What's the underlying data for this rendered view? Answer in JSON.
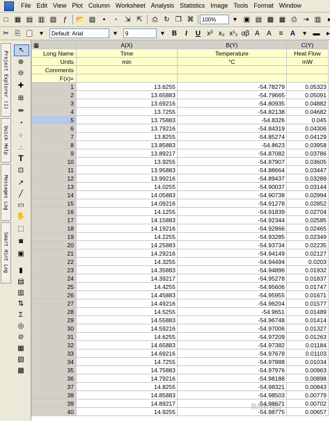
{
  "menu": [
    "File",
    "Edit",
    "View",
    "Plot",
    "Column",
    "Worksheet",
    "Analysis",
    "Statistics",
    "Image",
    "Tools",
    "Format",
    "Window"
  ],
  "toolbar": {
    "zoom": "100%",
    "font": "Default: Arial",
    "size": "9"
  },
  "side_tabs": [
    "Project Explorer (1)",
    "Quick Help",
    "Messages Log",
    "Smart Hint Log"
  ],
  "columns": [
    {
      "header": "A(X)",
      "long_name": "Time",
      "units": "min"
    },
    {
      "header": "B(Y)",
      "long_name": "Temperature",
      "units": "°C"
    },
    {
      "header": "C(Y)",
      "long_name": "Heat Flow",
      "units": "mW"
    }
  ],
  "meta_labels": [
    "Long Name",
    "Units",
    "Comments",
    "F(x)="
  ],
  "rows": [
    [
      "1",
      "13.6255",
      "-54.78279",
      "0.05323"
    ],
    [
      "2",
      "13.65883",
      "-54.79665",
      "0.05091"
    ],
    [
      "3",
      "13.69216",
      "-54.80935",
      "0.04882"
    ],
    [
      "4",
      "13.7255",
      "-54.82138",
      "0.04682"
    ],
    [
      "5",
      "13.75883",
      "-54.8326",
      "0.045"
    ],
    [
      "6",
      "13.79216",
      "-54.84319",
      "0.04306"
    ],
    [
      "7",
      "13.8255",
      "-54.85274",
      "0.04129"
    ],
    [
      "8",
      "13.85883",
      "-54.8623",
      "0.03958"
    ],
    [
      "9",
      "13.89217",
      "-54.87082",
      "0.03786"
    ],
    [
      "10",
      "13.9255",
      "-54.87907",
      "0.03605"
    ],
    [
      "11",
      "13.95883",
      "-54.88664",
      "0.03447"
    ],
    [
      "12",
      "13.99216",
      "-54.89437",
      "0.03289"
    ],
    [
      "13",
      "14.0255",
      "-54.90037",
      "0.03144"
    ],
    [
      "14",
      "14.05883",
      "-54.90738",
      "0.02994"
    ],
    [
      "15",
      "14.09216",
      "-54.91278",
      "0.02852"
    ],
    [
      "16",
      "14.1255",
      "-54.91839",
      "0.02704"
    ],
    [
      "17",
      "14.15883",
      "-54.92344",
      "0.02585"
    ],
    [
      "18",
      "14.19216",
      "-54.92866",
      "0.02465"
    ],
    [
      "19",
      "14.2255",
      "-54.93285",
      "0.02349"
    ],
    [
      "20",
      "14.25883",
      "-54.93734",
      "0.02235"
    ],
    [
      "21",
      "14.29216",
      "-54.94149",
      "0.02127"
    ],
    [
      "22",
      "14.3255",
      "-54.94494",
      "0.0203"
    ],
    [
      "23",
      "14.35883",
      "-54.94896",
      "0.01932"
    ],
    [
      "24",
      "14.39217",
      "-54.95278",
      "0.01837"
    ],
    [
      "25",
      "14.4255",
      "-54.95606",
      "0.01747"
    ],
    [
      "26",
      "14.45883",
      "-54.95955",
      "0.01671"
    ],
    [
      "27",
      "14.49216",
      "-54.96204",
      "0.01577"
    ],
    [
      "28",
      "14.5255",
      "-54.9651",
      "0.01489"
    ],
    [
      "29",
      "14.55883",
      "-54.96748",
      "0.01414"
    ],
    [
      "30",
      "14.59216",
      "-54.97006",
      "0.01327"
    ],
    [
      "31",
      "14.6255",
      "-54.97209",
      "0.01263"
    ],
    [
      "32",
      "14.65883",
      "-54.97382",
      "0.01184"
    ],
    [
      "33",
      "14.69216",
      "-54.97678",
      "0.01103"
    ],
    [
      "34",
      "14.7255",
      "-54.97888",
      "0.01034"
    ],
    [
      "35",
      "14.75883",
      "-54.97976",
      "0.00963"
    ],
    [
      "36",
      "14.79216",
      "-54.98188",
      "0.00898"
    ],
    [
      "37",
      "14.8255",
      "-54.98321",
      "0.00843"
    ],
    [
      "38",
      "14.85883",
      "-54.98503",
      "0.00779"
    ],
    [
      "39",
      "14.89217",
      "-54.98671",
      "0.00702"
    ],
    [
      "40",
      "14.9255",
      "-54.98775",
      "0.00657"
    ]
  ],
  "selected_row": "5",
  "watermark": "热分析动态"
}
